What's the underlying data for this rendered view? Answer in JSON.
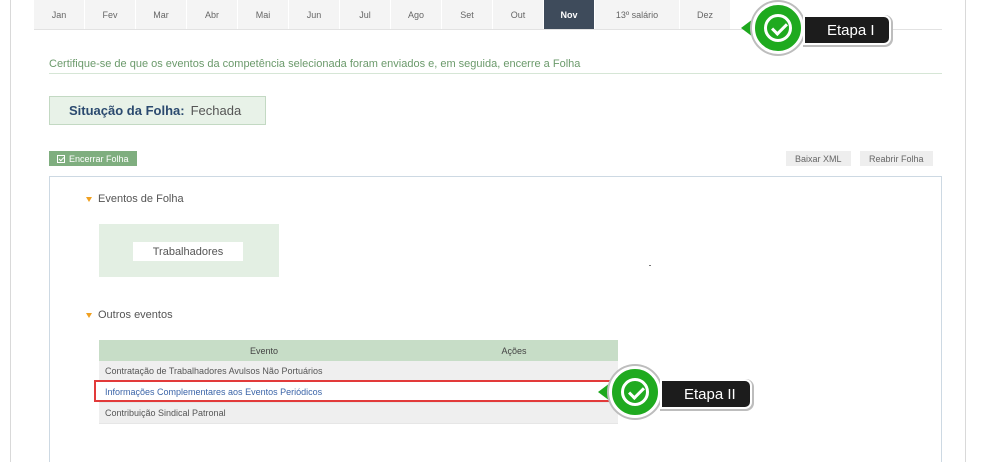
{
  "months": [
    {
      "label": "Jan",
      "active": false
    },
    {
      "label": "Fev",
      "active": false
    },
    {
      "label": "Mar",
      "active": false
    },
    {
      "label": "Abr",
      "active": false
    },
    {
      "label": "Mai",
      "active": false
    },
    {
      "label": "Jun",
      "active": false
    },
    {
      "label": "Jul",
      "active": false
    },
    {
      "label": "Ago",
      "active": false
    },
    {
      "label": "Set",
      "active": false
    },
    {
      "label": "Out",
      "active": false
    },
    {
      "label": "Nov",
      "active": true
    },
    {
      "label": "13º salário",
      "active": false
    },
    {
      "label": "Dez",
      "active": false
    }
  ],
  "instruction": "Certifique-se de que os eventos da competência selecionada foram enviados e, em seguida, encerre a Folha",
  "status": {
    "label": "Situação da Folha:",
    "value": "Fechada"
  },
  "actions": {
    "close_payroll": "Encerrar Folha",
    "download_xml": "Baixar XML",
    "reopen_payroll": "Reabrir Folha"
  },
  "payroll_events": {
    "title": "Eventos de Folha",
    "workers_button": "Trabalhadores"
  },
  "other_events": {
    "title": "Outros eventos",
    "columns": {
      "event": "Evento",
      "actions": "Ações"
    },
    "rows": [
      "Contratação de Trabalhadores Avulsos Não Portuários",
      "Informações Complementares aos Eventos Periódicos",
      "Contribuição Sindical Patronal"
    ]
  },
  "callouts": {
    "step1": "Etapa I",
    "step2": "Etapa II"
  },
  "colors": {
    "active_tab": "#3e4b5b",
    "accent_green": "#1faa1f",
    "highlight_red": "#e23a3a",
    "header_green": "#c7ddc7"
  }
}
